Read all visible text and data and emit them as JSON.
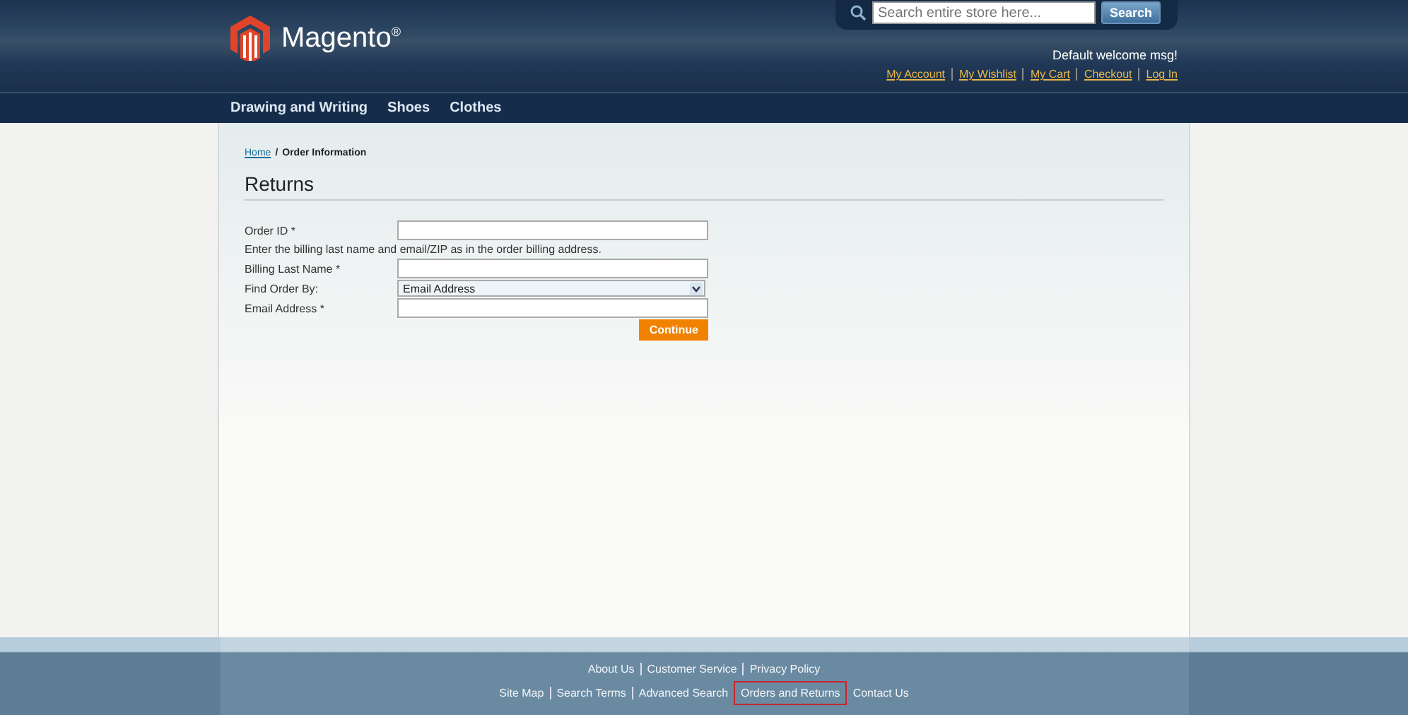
{
  "header": {
    "logo_text": "Magento",
    "logo_mark": "®",
    "search": {
      "placeholder": "Search entire store here...",
      "button": "Search"
    },
    "welcome": "Default welcome msg!",
    "links": [
      "My Account",
      "My Wishlist",
      "My Cart",
      "Checkout",
      "Log In"
    ]
  },
  "nav": [
    "Drawing and Writing",
    "Shoes",
    "Clothes"
  ],
  "breadcrumb": {
    "link": "Home",
    "separator": "/",
    "current": "Order Information"
  },
  "title": "Returns",
  "form": {
    "fields": [
      {
        "kind": "input",
        "label": "Order ID *"
      },
      {
        "kind": "note",
        "label": "Enter the billing last name and email/ZIP as in the order billing address."
      },
      {
        "kind": "input",
        "label": "Billing Last Name *"
      },
      {
        "kind": "select",
        "label": "Find Order By:",
        "value": "Email Address"
      },
      {
        "kind": "input",
        "label": "Email Address *"
      }
    ],
    "button": "Continue"
  },
  "footer": {
    "info_links": [
      {
        "label": "About Us",
        "highlighted": false
      },
      {
        "label": "Customer Service",
        "highlighted": false
      },
      {
        "label": "Privacy Policy",
        "highlighted": false
      }
    ],
    "site_links": [
      {
        "label": "Site Map",
        "highlighted": false
      },
      {
        "label": "Search Terms",
        "highlighted": false
      },
      {
        "label": "Advanced Search",
        "highlighted": false
      },
      {
        "label": "Orders and Returns",
        "highlighted": true
      },
      {
        "label": "Contact Us",
        "highlighted": false
      }
    ]
  }
}
